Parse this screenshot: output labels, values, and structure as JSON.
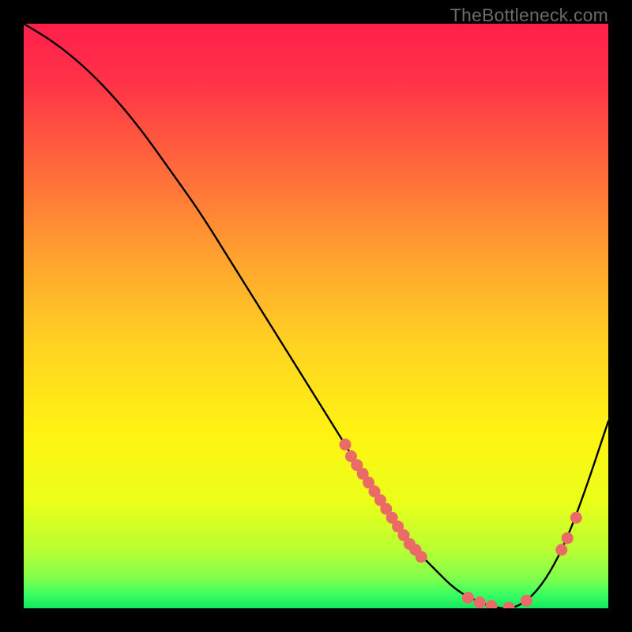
{
  "watermark": "TheBottleneck.com",
  "colors": {
    "gradient_stops": [
      {
        "offset": 0.0,
        "color": "#ff1f4a"
      },
      {
        "offset": 0.1,
        "color": "#ff3348"
      },
      {
        "offset": 0.25,
        "color": "#ff6a3b"
      },
      {
        "offset": 0.4,
        "color": "#ffa22f"
      },
      {
        "offset": 0.55,
        "color": "#ffd321"
      },
      {
        "offset": 0.7,
        "color": "#fff312"
      },
      {
        "offset": 0.82,
        "color": "#e9ff1a"
      },
      {
        "offset": 0.9,
        "color": "#b8ff33"
      },
      {
        "offset": 0.95,
        "color": "#7dff4d"
      },
      {
        "offset": 0.975,
        "color": "#3dff62"
      },
      {
        "offset": 1.0,
        "color": "#13e85f"
      }
    ],
    "curve": "#000000",
    "marker": "#e96a67",
    "background": "#000000"
  },
  "chart_data": {
    "type": "line",
    "title": "",
    "xlabel": "",
    "ylabel": "",
    "xlim": [
      0,
      100
    ],
    "ylim": [
      0,
      100
    ],
    "legend": false,
    "grid": false,
    "series": [
      {
        "name": "bottleneck-curve",
        "x": [
          0,
          5,
          10,
          15,
          20,
          25,
          30,
          35,
          40,
          45,
          50,
          55,
          58,
          62,
          66,
          70,
          74,
          78,
          81,
          84,
          87,
          90,
          93,
          96,
          100
        ],
        "values": [
          100,
          97,
          93,
          88,
          82,
          75,
          68,
          60,
          52,
          44,
          36,
          28,
          23,
          17,
          11,
          7,
          3,
          1,
          0,
          0,
          2,
          6,
          12,
          20,
          32
        ]
      }
    ],
    "markers": [
      {
        "x": 55,
        "y": 28
      },
      {
        "x": 56,
        "y": 26
      },
      {
        "x": 57,
        "y": 24.5
      },
      {
        "x": 58,
        "y": 23
      },
      {
        "x": 59,
        "y": 21.5
      },
      {
        "x": 60,
        "y": 20
      },
      {
        "x": 61,
        "y": 18.5
      },
      {
        "x": 62,
        "y": 17
      },
      {
        "x": 63,
        "y": 15.5
      },
      {
        "x": 64,
        "y": 14
      },
      {
        "x": 65,
        "y": 12.5
      },
      {
        "x": 66,
        "y": 11
      },
      {
        "x": 67,
        "y": 10
      },
      {
        "x": 68,
        "y": 8.8
      },
      {
        "x": 76,
        "y": 1.8
      },
      {
        "x": 78,
        "y": 1.0
      },
      {
        "x": 80,
        "y": 0.4
      },
      {
        "x": 83,
        "y": 0.1
      },
      {
        "x": 86,
        "y": 1.3
      },
      {
        "x": 92,
        "y": 10
      },
      {
        "x": 93,
        "y": 12
      },
      {
        "x": 94.5,
        "y": 15.5
      }
    ]
  }
}
